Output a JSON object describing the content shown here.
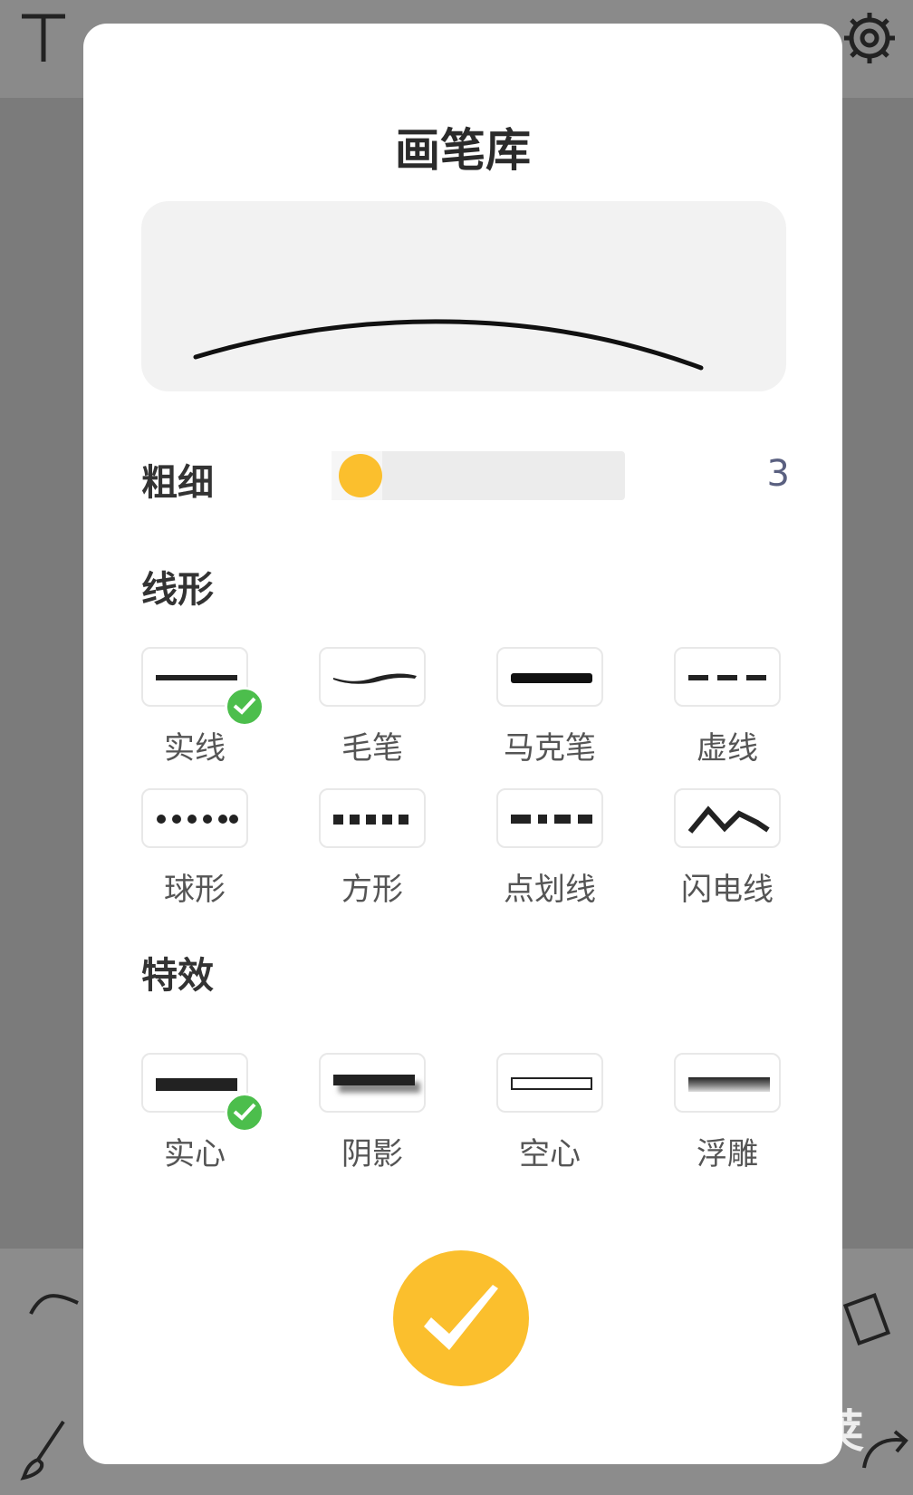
{
  "dialog": {
    "title": "画笔库",
    "thickness": {
      "label": "粗细",
      "value": "3",
      "fraction": 0.03
    },
    "line_types": {
      "heading": "线形",
      "items": [
        {
          "label": "实线",
          "selected": true
        },
        {
          "label": "毛笔",
          "selected": false
        },
        {
          "label": "马克笔",
          "selected": false
        },
        {
          "label": "虚线",
          "selected": false
        },
        {
          "label": "球形",
          "selected": false
        },
        {
          "label": "方形",
          "selected": false
        },
        {
          "label": "点划线",
          "selected": false
        },
        {
          "label": "闪电线",
          "selected": false
        }
      ]
    },
    "effects": {
      "heading": "特效",
      "items": [
        {
          "label": "实心",
          "selected": true
        },
        {
          "label": "阴影",
          "selected": false
        },
        {
          "label": "空心",
          "selected": false
        },
        {
          "label": "浮雕",
          "selected": false
        }
      ]
    }
  },
  "watermark": "豌豆荚",
  "colors": {
    "accent": "#fbbf2d",
    "check": "#4cbe4c",
    "value_text": "#5a6080"
  }
}
